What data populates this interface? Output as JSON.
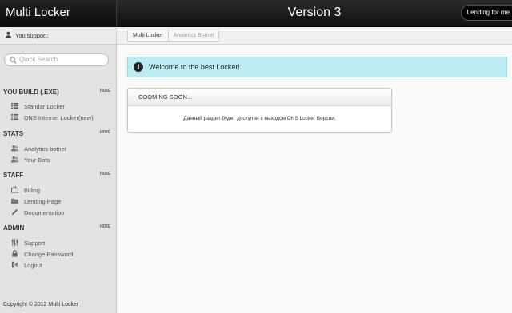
{
  "header": {
    "brand": "Multi Locker",
    "version": "Version 3",
    "lending_button": "Lending for me"
  },
  "sidebar": {
    "support_label": "You support:",
    "search_placeholder": "Quick Search",
    "sections": [
      {
        "title": "YOU BUILD (.EXE)",
        "hide": "HIDE",
        "items": [
          {
            "label": "Standar Locker",
            "icon": "list-icon"
          },
          {
            "label": "DNS Internet Locker(new)",
            "icon": "list-icon"
          }
        ]
      },
      {
        "title": "STATS",
        "hide": "HIDE",
        "items": [
          {
            "label": "Analytics botnet",
            "icon": "users-icon"
          },
          {
            "label": "Your Bots",
            "icon": "users-icon"
          }
        ]
      },
      {
        "title": "STAFF",
        "hide": "HIDE",
        "items": [
          {
            "label": "Billing",
            "icon": "briefcase-icon"
          },
          {
            "label": "Lending Page",
            "icon": "folder-icon"
          },
          {
            "label": "Documentation",
            "icon": "pencil-icon"
          }
        ]
      },
      {
        "title": "ADMIN",
        "hide": "HIDE",
        "items": [
          {
            "label": "Support",
            "icon": "sliders-icon"
          },
          {
            "label": "Change Password",
            "icon": "lock-icon"
          },
          {
            "label": "Logout",
            "icon": "logout-icon"
          }
        ]
      }
    ],
    "copyright": "Copyright © 2012 Multi Locker"
  },
  "breadcrumb": {
    "items": [
      "Multi Locker",
      "Analetics Botnet"
    ]
  },
  "alert": {
    "text": "Welcome to the best Locker!"
  },
  "panel": {
    "title": "COOMING SOON...",
    "body": "Данный раздел будет доступен с выходом DNS Locker Версии."
  },
  "colors": {
    "header_bg": "#111111",
    "sidebar_bg": "#e3e3e3",
    "alert_bg": "#bcecf2",
    "alert_border": "#95d6e0"
  }
}
